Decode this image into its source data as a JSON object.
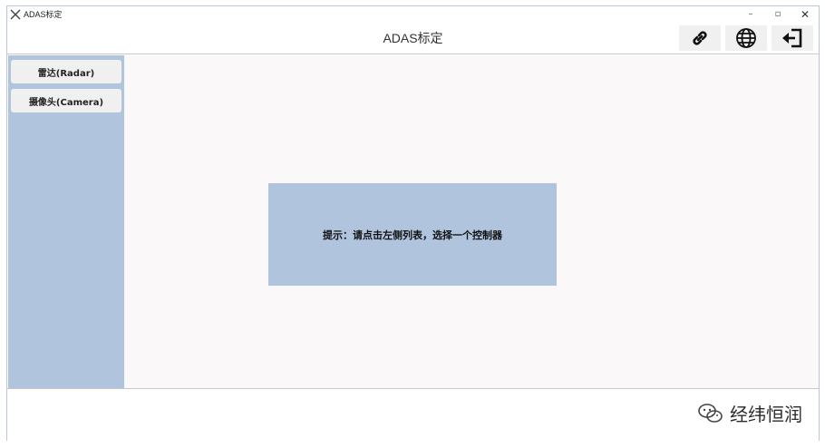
{
  "window": {
    "app_title": "ADAS标定",
    "controls": {
      "minimize": "–",
      "maximize": "▫",
      "close": "✕"
    }
  },
  "header": {
    "title": "ADAS标定",
    "buttons": [
      {
        "icon": "link-icon"
      },
      {
        "icon": "globe-icon"
      },
      {
        "icon": "logout-icon"
      }
    ]
  },
  "sidebar": {
    "items": [
      {
        "label": "雷达(Radar)"
      },
      {
        "label": "摄像头(Camera)"
      }
    ]
  },
  "main": {
    "hint": "提示：请点击左侧列表，选择一个控制器"
  },
  "footer": {
    "watermark_text": "经纬恒润"
  },
  "colors": {
    "sidebar_bg": "#b1c4de",
    "hint_bg": "#b1c4de",
    "main_bg": "#fbf8fa",
    "button_bg": "#f0f0f0"
  }
}
